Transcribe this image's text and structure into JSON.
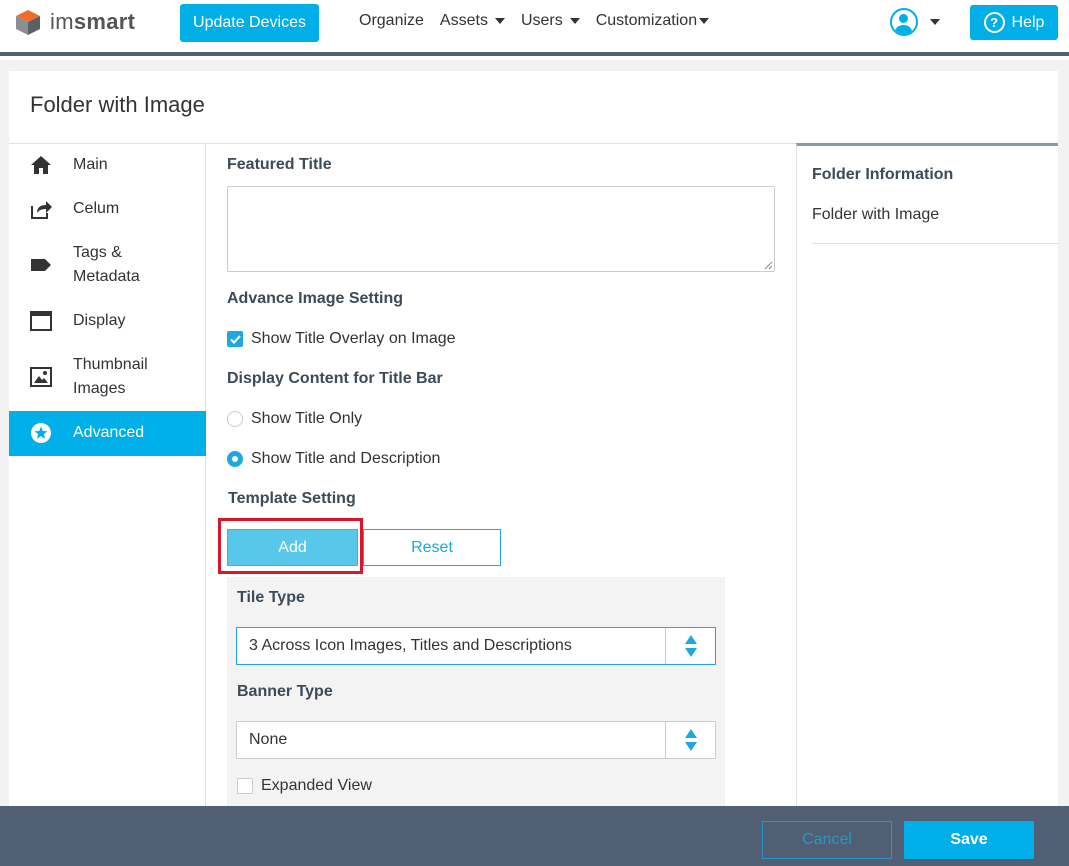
{
  "app": {
    "logo_prefix": "im",
    "logo_suffix": "smart",
    "update_button": "Update Devices",
    "help_button": "Help"
  },
  "nav": {
    "items": [
      {
        "label": "Organize",
        "dropdown": false
      },
      {
        "label": "Assets",
        "dropdown": true
      },
      {
        "label": "Users",
        "dropdown": true
      },
      {
        "label": "Customization",
        "dropdown": true
      }
    ]
  },
  "page": {
    "title": "Folder with Image"
  },
  "sidebar": {
    "items": [
      {
        "label": "Main",
        "icon": "home-icon"
      },
      {
        "label": "Celum",
        "icon": "share-icon"
      },
      {
        "label": "Tags & Metadata",
        "icon": "tag-icon"
      },
      {
        "label": "Display",
        "icon": "window-icon"
      },
      {
        "label": "Thumbnail Images",
        "icon": "image-icon"
      },
      {
        "label": "Advanced",
        "icon": "star-icon",
        "active": true
      }
    ]
  },
  "form": {
    "featured_title_label": "Featured Title",
    "featured_title_value": "",
    "advance_image_label": "Advance Image Setting",
    "show_overlay_label": "Show Title Overlay on Image",
    "show_overlay_checked": true,
    "title_bar_label": "Display Content for Title Bar",
    "radio_title_only": "Show Title Only",
    "radio_title_desc": "Show Title and Description",
    "selected_radio": "Show Title and Description",
    "template_label": "Template Setting",
    "add_button": "Add",
    "reset_button": "Reset",
    "tile_type_label": "Tile Type",
    "tile_type_value": "3 Across Icon Images, Titles and Descriptions",
    "banner_type_label": "Banner Type",
    "banner_type_value": "None",
    "expanded_view_label": "Expanded View",
    "expanded_view_checked": false
  },
  "info": {
    "title": "Folder Information",
    "value": "Folder with Image"
  },
  "footer": {
    "cancel_button": "Cancel",
    "save_button": "Save"
  },
  "colors": {
    "accent": "#00aee8",
    "header_dark": "#505f73",
    "highlight_border": "#d9162a"
  }
}
